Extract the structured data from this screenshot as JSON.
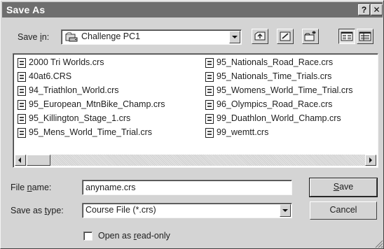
{
  "window": {
    "title": "Save As"
  },
  "titlebar_buttons": {
    "help": "?",
    "close": "✕"
  },
  "save_in": {
    "label_prefix": "Save ",
    "label_accel": "i",
    "label_suffix": "n:",
    "folder_icon": "drive-folder-icon",
    "value": "Challenge PC1"
  },
  "toolbar": {
    "up_icon": "up-one-level-icon",
    "desktop_icon": "desktop-icon",
    "new_folder_icon": "new-folder-icon",
    "list_view_icon": "list-view-icon",
    "details_view_icon": "details-view-icon"
  },
  "files": {
    "column1": [
      "2000 Tri Worlds.crs",
      "40at6.CRS",
      "94_Triathlon_World.crs",
      "95_European_MtnBike_Champ.crs",
      "95_Killington_Stage_1.crs",
      "95_Mens_World_Time_Trial.crs"
    ],
    "column2": [
      "95_Nationals_Road_Race.crs",
      "95_Nationals_Time_Trials.crs",
      "95_Womens_World_Time_Trial.crs",
      "96_Olympics_Road_Race.crs",
      "99_Duathlon_World_Champ.crs",
      "99_wemtt.crs"
    ]
  },
  "file_name": {
    "label_prefix": "File ",
    "label_accel": "n",
    "label_suffix": "ame:",
    "value": "anyname.crs"
  },
  "save_as_type": {
    "label_prefix": "Save as ",
    "label_accel": "t",
    "label_suffix": "ype:",
    "value": "Course File (*.crs)"
  },
  "buttons": {
    "save_accel": "S",
    "save_rest": "ave",
    "cancel": "Cancel"
  },
  "read_only": {
    "label_prefix": "Open as ",
    "label_accel": "r",
    "label_suffix": "ead-only",
    "checked": false
  }
}
